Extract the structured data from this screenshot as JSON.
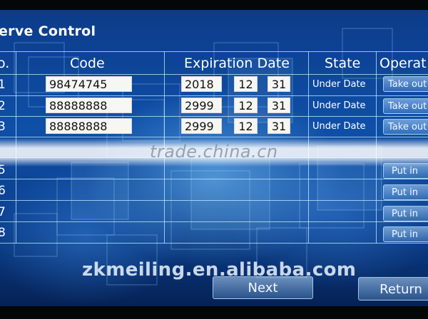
{
  "title": "erve Control",
  "columns": {
    "no": "o.",
    "code": "Code",
    "expiration": "Expiration Date",
    "state": "State",
    "operation": "Operat"
  },
  "rows": [
    {
      "no": "1",
      "code": "98474745",
      "year": "2018",
      "month": "12",
      "day": "31",
      "state": "Under Date",
      "action": "Take out"
    },
    {
      "no": "2",
      "code": "88888888",
      "year": "2999",
      "month": "12",
      "day": "31",
      "state": "Under Date",
      "action": "Take out"
    },
    {
      "no": "3",
      "code": "88888888",
      "year": "2999",
      "month": "12",
      "day": "31",
      "state": "Under Date",
      "action": "Take out"
    },
    {
      "no": "5",
      "action": "Put in"
    },
    {
      "no": "6",
      "action": "Put in"
    },
    {
      "no": "7",
      "action": "Put in"
    },
    {
      "no": "8",
      "action": "Put in"
    }
  ],
  "watermarks": {
    "top": "trade.china.cn",
    "bottom": "zkmeiling.en.alibaba.com"
  },
  "footer": {
    "next_label": "Next",
    "return_label": "Return"
  }
}
